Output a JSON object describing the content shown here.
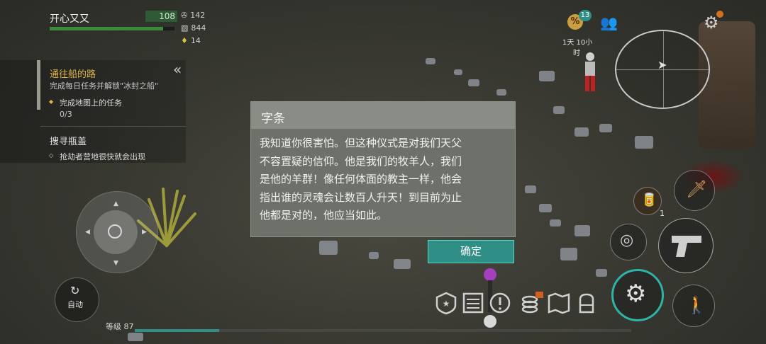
{
  "player": {
    "name": "开心又又",
    "health": "108",
    "health_fraction": 0.91,
    "stats": [
      {
        "icon": "energy-icon",
        "value": "142"
      },
      {
        "icon": "food-icon",
        "value": "844"
      },
      {
        "icon": "water-icon",
        "value": "14"
      }
    ]
  },
  "quests": {
    "items": [
      {
        "title": "通往船的路",
        "subtitle": "完成每日任务并解锁\"冰封之船\"",
        "task": "完成地图上的任务",
        "progress": "0/3",
        "title_color": "#e0b24a"
      },
      {
        "title": "搜寻瓶盖",
        "task": "抢劫者营地很快就会出现",
        "title_color": "#e6e6e6"
      }
    ]
  },
  "dialog": {
    "title": "字条",
    "lines": [
      "我知道你很害怕。但这种仪式是对我们天父",
      "不容置疑的信仰。他是我们的牧羊人，我们",
      "是他的羊群！像任何体面的教主一样，他会",
      "指出谁的灵魂会让数百人升天！到目前为止",
      "他都是对的，他应当如此。"
    ],
    "confirm_label": "确定"
  },
  "hud": {
    "discount_badge": "13",
    "discount_symbol": "%",
    "timer_line1": "1天 10小",
    "timer_line2": "时",
    "auto_label": "自动",
    "level_label": "等级 87",
    "xp_fraction": 0.17,
    "food_count": "1"
  },
  "colors": {
    "accent": "#2f8f86",
    "quest_gold": "#e0b24a",
    "health_green": "#3b8a3e"
  }
}
